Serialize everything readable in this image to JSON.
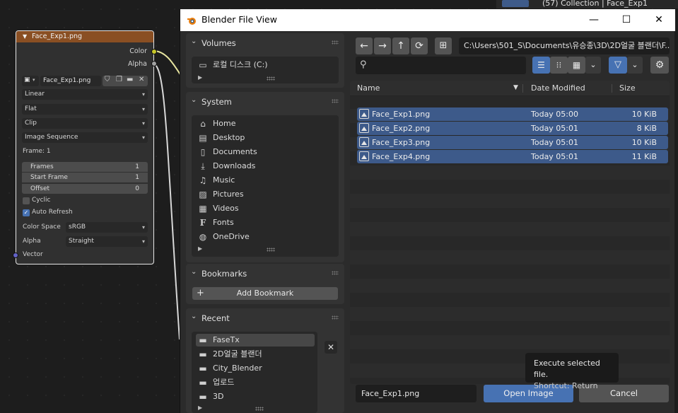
{
  "node": {
    "title": "Face_Exp1.png",
    "outputs": {
      "color": "Color",
      "alpha": "Alpha"
    },
    "image_field": "Face_Exp1.png",
    "interpolation": "Linear",
    "projection": "Flat",
    "extension": "Clip",
    "source": "Image Sequence",
    "frame_label": "Frame: 1",
    "frames": {
      "label": "Frames",
      "value": "1"
    },
    "start_frame": {
      "label": "Start Frame",
      "value": "1"
    },
    "offset": {
      "label": "Offset",
      "value": "0"
    },
    "cyclic": {
      "label": "Cyclic",
      "checked": false
    },
    "auto_refresh": {
      "label": "Auto Refresh",
      "checked": true
    },
    "color_space": {
      "label": "Color Space",
      "value": "sRGB"
    },
    "alpha": {
      "label": "Alpha",
      "value": "Straight"
    },
    "input": "Vector",
    "colors": {
      "header": "#8a4f23",
      "color_socket": "#c7c729",
      "alpha_socket": "#a1a1a1",
      "vector_socket": "#6363c7"
    }
  },
  "outliner": {
    "label": "(57) Collection | Face_Exp1"
  },
  "dialog": {
    "title": "Blender File View",
    "window_buttons": {
      "minimize": "—",
      "maximize": "☐",
      "close": "✕"
    },
    "volumes": {
      "title": "Volumes",
      "items": [
        {
          "label": "로컬 디스크 (C:)",
          "icon": "drive-icon"
        }
      ]
    },
    "system": {
      "title": "System",
      "items": [
        {
          "label": "Home",
          "icon": "home-icon"
        },
        {
          "label": "Desktop",
          "icon": "desktop-icon"
        },
        {
          "label": "Documents",
          "icon": "documents-icon"
        },
        {
          "label": "Downloads",
          "icon": "download-icon"
        },
        {
          "label": "Music",
          "icon": "music-icon"
        },
        {
          "label": "Pictures",
          "icon": "picture-icon"
        },
        {
          "label": "Videos",
          "icon": "video-icon"
        },
        {
          "label": "Fonts",
          "icon": "font-icon"
        },
        {
          "label": "OneDrive",
          "icon": "globe-icon"
        }
      ]
    },
    "bookmarks": {
      "title": "Bookmarks",
      "add_label": "Add Bookmark"
    },
    "recent": {
      "title": "Recent",
      "items": [
        {
          "label": "FaseTx",
          "selected": true
        },
        {
          "label": "2D얼굴 블랜더"
        },
        {
          "label": "City_Blender"
        },
        {
          "label": "업로드"
        },
        {
          "label": "3D"
        }
      ]
    },
    "path": "C:\\Users\\501_S\\Documents\\유승종\\3D\\2D얼굴 블랜더\\F...",
    "search": {
      "value": "",
      "placeholder": ""
    },
    "columns": {
      "name": "Name",
      "date": "Date Modified",
      "size": "Size"
    },
    "files": [
      {
        "name": "Face_Exp1.png",
        "date": "Today 05:00",
        "size": "10 KiB"
      },
      {
        "name": "Face_Exp2.png",
        "date": "Today 05:01",
        "size": "8 KiB"
      },
      {
        "name": "Face_Exp3.png",
        "date": "Today 05:01",
        "size": "10 KiB"
      },
      {
        "name": "Face_Exp4.png",
        "date": "Today 05:01",
        "size": "11 KiB"
      }
    ],
    "filename": "Face_Exp1.png",
    "open_label": "Open Image",
    "cancel_label": "Cancel",
    "tooltip": {
      "line1": "Execute selected file.",
      "line2": "Shortcut: Return"
    },
    "colors": {
      "accent": "#4772b3",
      "selection": "#3d5a8a"
    }
  }
}
